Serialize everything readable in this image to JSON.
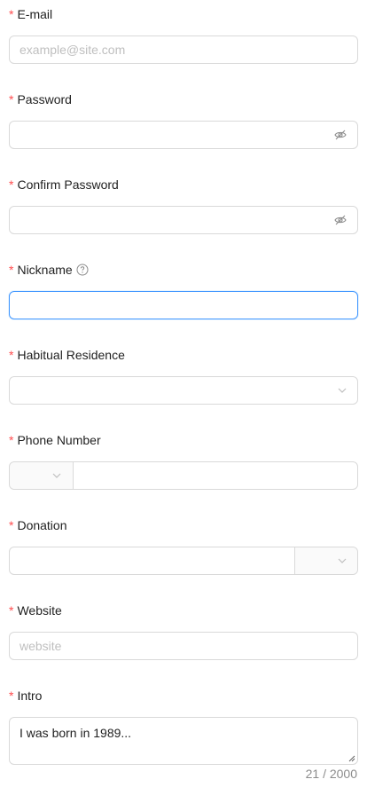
{
  "form": {
    "email": {
      "label": "E-mail",
      "placeholder": "example@site.com",
      "value": ""
    },
    "password": {
      "label": "Password",
      "value": ""
    },
    "confirm_password": {
      "label": "Confirm Password",
      "value": ""
    },
    "nickname": {
      "label": "Nickname",
      "value": ""
    },
    "residence": {
      "label": "Habitual Residence",
      "value": ""
    },
    "phone": {
      "label": "Phone Number",
      "prefix": "",
      "value": ""
    },
    "donation": {
      "label": "Donation",
      "value": "",
      "suffix": ""
    },
    "website": {
      "label": "Website",
      "placeholder": "website",
      "value": ""
    },
    "intro": {
      "label": "Intro",
      "value": "I was born in 1989...",
      "count": "21 / 2000"
    }
  },
  "colors": {
    "required": "#ff4d4f",
    "focus_border": "#4096ff",
    "border": "#d9d9d9"
  },
  "icons": {
    "password_toggle": "eye-invisible-icon",
    "help": "question-circle-icon",
    "select": "chevron-down-icon"
  }
}
